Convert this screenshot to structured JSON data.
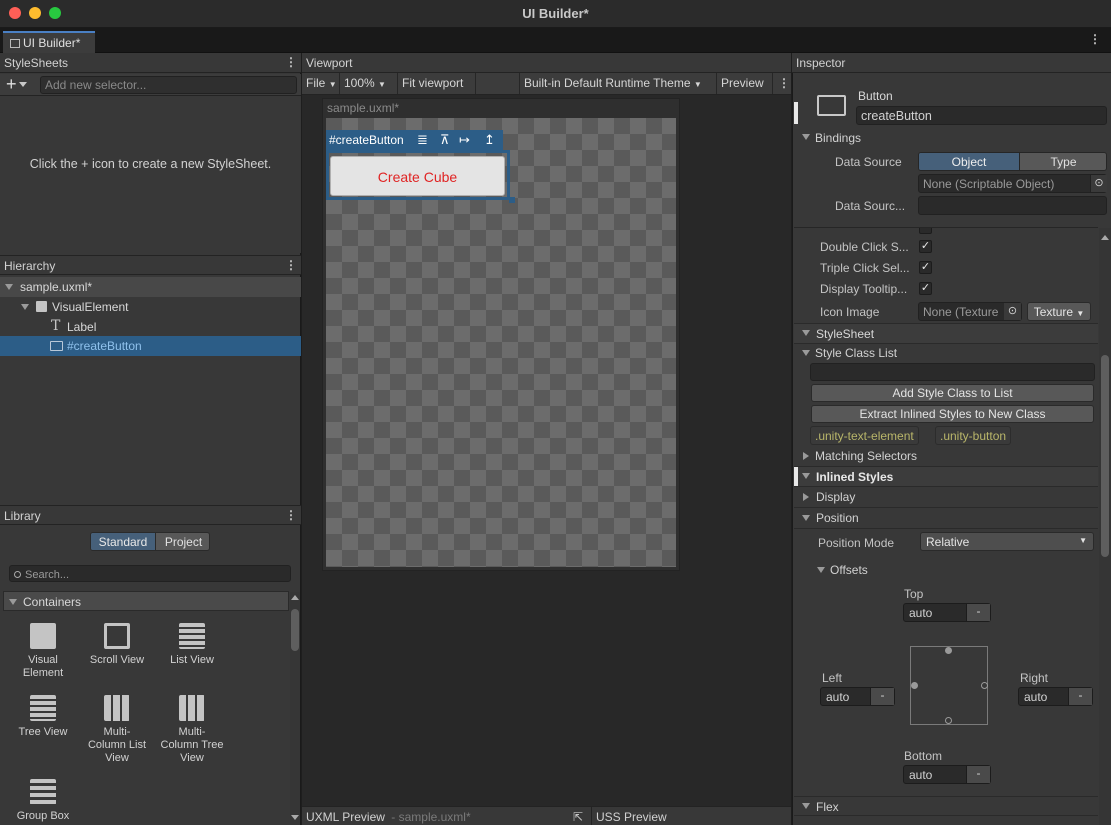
{
  "window": {
    "title": "UI Builder*",
    "tab_label": "UI Builder*"
  },
  "stylesheets": {
    "title": "StyleSheets",
    "add_placeholder": "Add new selector...",
    "empty_message": "Click the + icon to create a new StyleSheet."
  },
  "hierarchy": {
    "title": "Hierarchy",
    "root": "sample.uxml*",
    "items": [
      {
        "label": "VisualElement"
      },
      {
        "label": "Label"
      },
      {
        "label": "#createButton"
      }
    ]
  },
  "library": {
    "title": "Library",
    "tabs": [
      "Standard",
      "Project"
    ],
    "search_placeholder": "Search...",
    "category": "Containers",
    "items": [
      "Visual Element",
      "Scroll View",
      "List View",
      "Tree View",
      "Multi-Column List View",
      "Multi-Column Tree View",
      "Group Box"
    ]
  },
  "viewport": {
    "title": "Viewport",
    "toolbar": {
      "file": "File",
      "zoom": "100%",
      "fit": "Fit viewport",
      "theme": "Built-in Default Runtime Theme",
      "preview": "Preview"
    },
    "canvas_title": "sample.uxml*",
    "selection_label": "#createButton",
    "button_text": "Create Cube",
    "button_text_color": "#e02424",
    "footer": {
      "uxml_preview": "UXML Preview",
      "uxml_file": "- sample.uxml*",
      "uss_preview": "USS Preview"
    }
  },
  "inspector": {
    "title": "Inspector",
    "element_type": "Button",
    "element_name": "createButton",
    "bindings": {
      "title": "Bindings",
      "data_source_label": "Data Source",
      "data_source_options": [
        "Object",
        "Type"
      ],
      "data_source_value": "None (Scriptable Object)",
      "data_source_path_label": "Data Sourc..."
    },
    "attributes": [
      {
        "label": "Double Click S...",
        "checked": true
      },
      {
        "label": "Triple Click Sel...",
        "checked": true
      },
      {
        "label": "Display Tooltip...",
        "checked": true
      }
    ],
    "icon_image": {
      "label": "Icon Image",
      "value": "None (Texture",
      "type": "Texture"
    },
    "stylesheet": {
      "title": "StyleSheet",
      "style_class_list": "Style Class List",
      "add_class_button": "Add Style Class to List",
      "extract_button": "Extract Inlined Styles to New Class",
      "classes": [
        ".unity-text-element",
        ".unity-button"
      ],
      "matching_selectors": "Matching Selectors"
    },
    "inlined_styles": {
      "title": "Inlined Styles",
      "display": "Display",
      "position": {
        "title": "Position",
        "mode_label": "Position Mode",
        "mode_value": "Relative",
        "offsets_label": "Offsets",
        "top_label": "Top",
        "top_value": "auto",
        "left_label": "Left",
        "left_value": "auto",
        "right_label": "Right",
        "right_value": "auto",
        "bottom_label": "Bottom",
        "bottom_value": "auto",
        "unit_symbol": "-"
      },
      "flex": "Flex"
    }
  },
  "colors": {
    "accent": "#4a80c4",
    "selection_row": "#2c5d87",
    "button_text": "#e02424",
    "class_tag": "#b9b66a"
  }
}
